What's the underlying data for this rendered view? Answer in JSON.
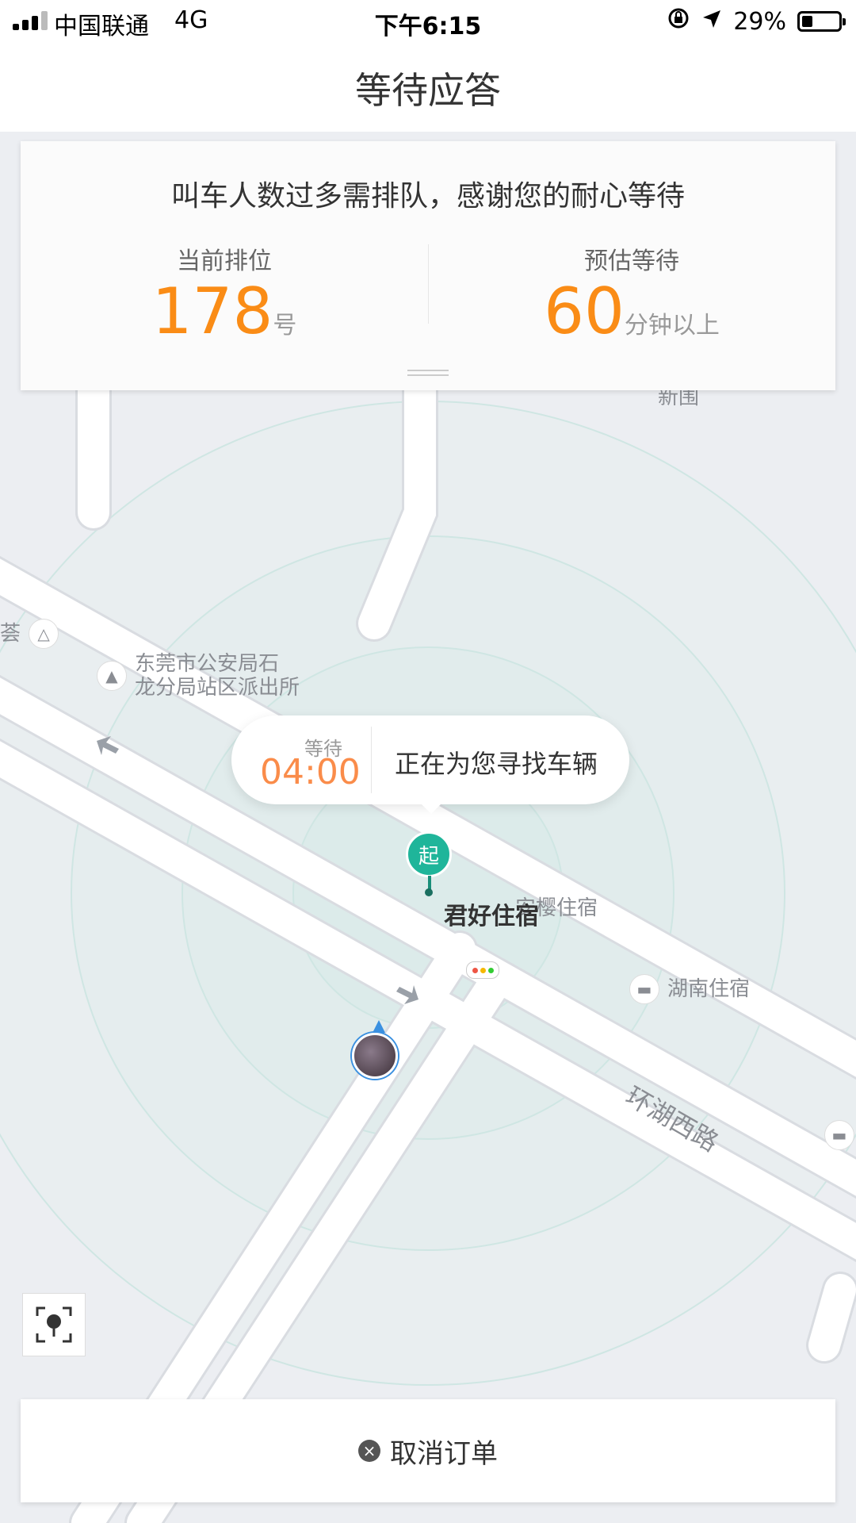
{
  "status_bar": {
    "carrier": "中国联通",
    "network": "4G",
    "time": "下午6:15",
    "battery_percent": "29%",
    "battery_level": 0.29
  },
  "nav": {
    "title": "等待应答"
  },
  "queue_card": {
    "message": "叫车人数过多需排队，感谢您的耐心等待",
    "position_label": "当前排位",
    "position_value": "178",
    "position_unit": "号",
    "wait_label": "预估等待",
    "wait_value": "60",
    "wait_unit": "分钟以上"
  },
  "map": {
    "labels": {
      "police_station_line1": "东莞市公安局石",
      "police_station_line2": "龙分局站区派出所",
      "hotel_anying": "安樱住宿",
      "hotel_hunan": "湖南住宿",
      "road_name": "环湖西路",
      "xinwei": "新围",
      "partial_left": "荟"
    },
    "pickup_point": {
      "pin_text": "起",
      "name": "君好住宿"
    }
  },
  "bubble": {
    "wait_label": "等待",
    "countdown": "04:00",
    "message": "正在为您寻找车辆"
  },
  "cancel": {
    "label": "取消订单",
    "icon": "close-circle-icon"
  },
  "colors": {
    "accent_orange": "#fa8c16",
    "pickup_green": "#1fb59a",
    "map_bg": "#eceef2"
  }
}
